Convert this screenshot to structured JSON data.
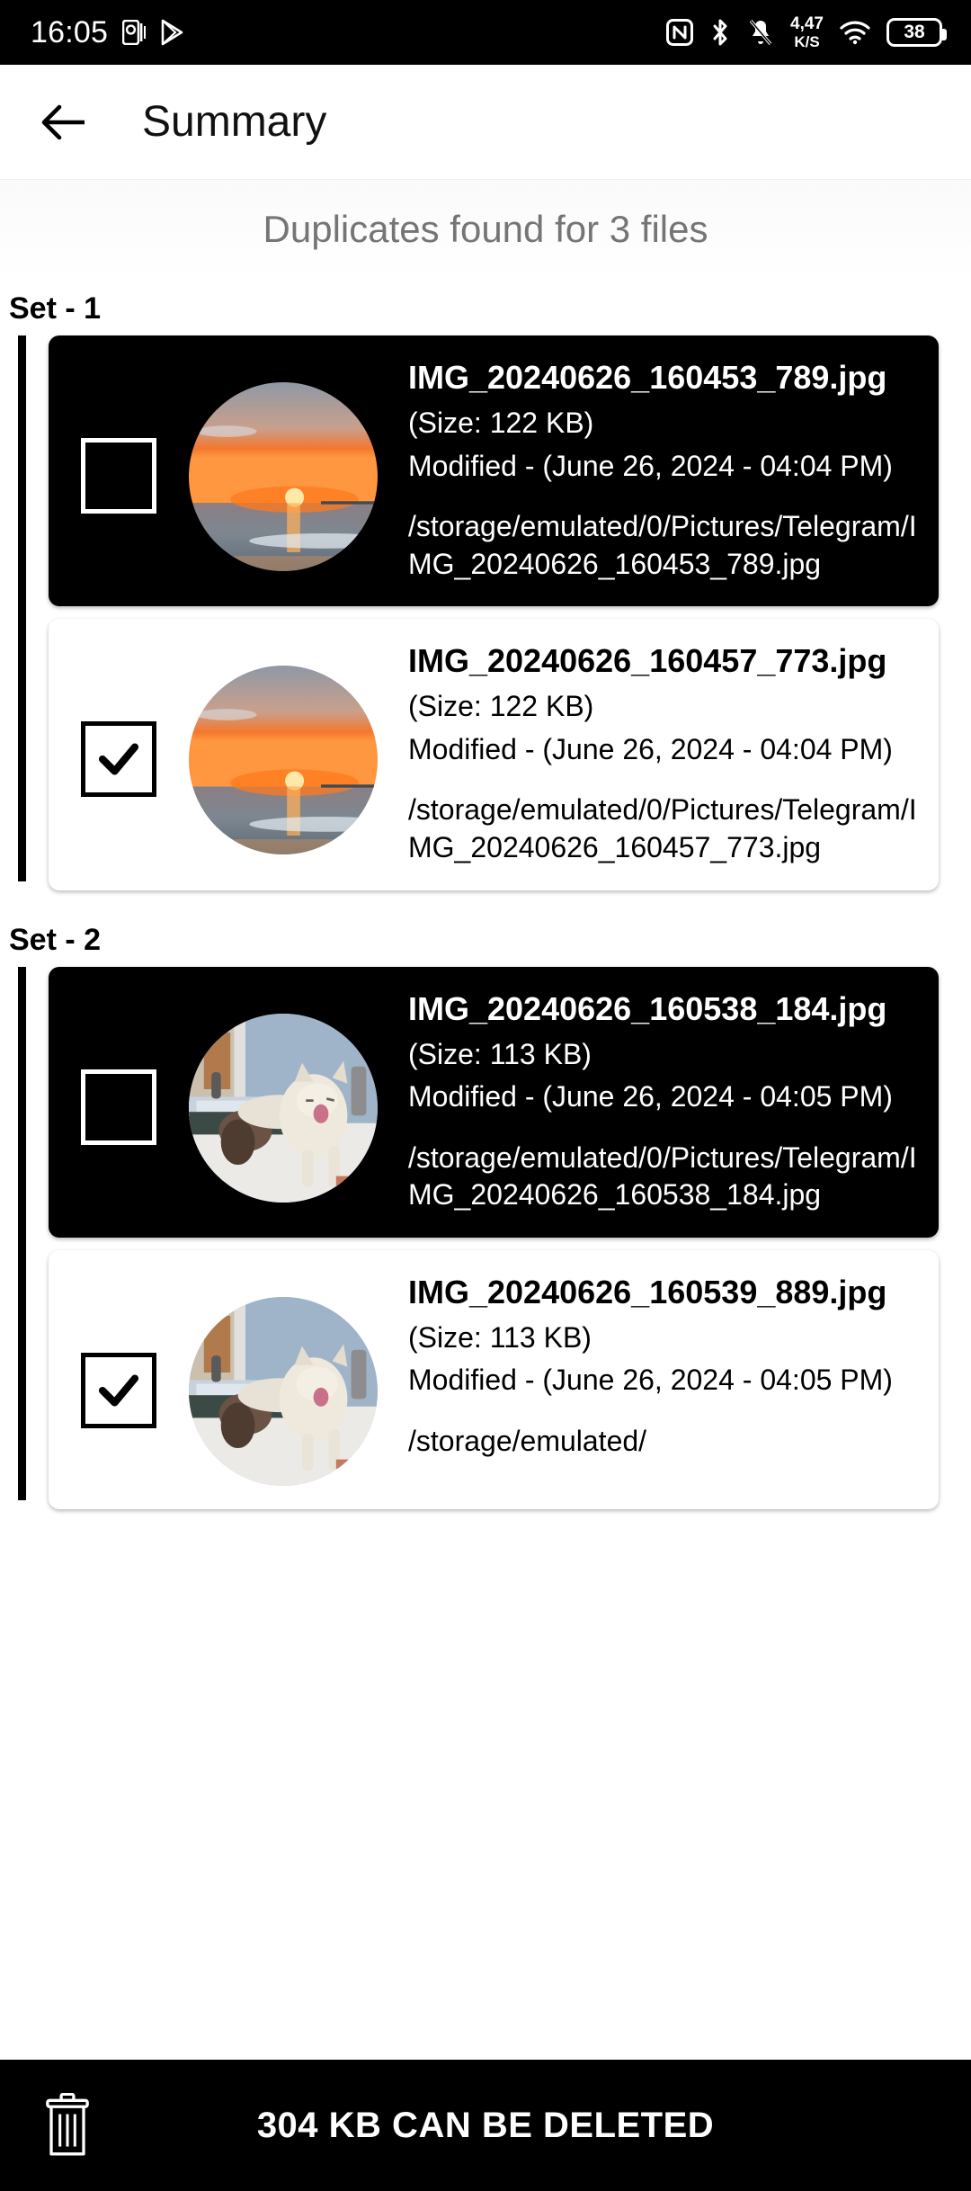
{
  "statusbar": {
    "time": "16:05",
    "left_icons": [
      "powerpoint-icon",
      "play-store-icon"
    ],
    "net_speed_value": "4,47",
    "net_speed_unit": "K/S",
    "battery_level": "38",
    "right_icons": [
      "nfc-icon",
      "bluetooth-icon",
      "notifications-off-icon",
      "wifi-icon",
      "battery-icon"
    ]
  },
  "appbar": {
    "back_label": "back-arrow",
    "title": "Summary"
  },
  "subtitle": "Duplicates found for 3 files",
  "sets": [
    {
      "label": "Set - 1",
      "files": [
        {
          "name": "IMG_20240626_160453_789.jpg",
          "size": "(Size: 122 KB)",
          "modified": "Modified - (June 26, 2024 - 04:04 PM)",
          "path": "/storage/emulated/0/Pictures/Telegram/IMG_20240626_160453_789.jpg",
          "selected": false,
          "theme": "dark",
          "thumbnail": "sunset-ocean-thumbnail"
        },
        {
          "name": "IMG_20240626_160457_773.jpg",
          "size": "(Size: 122 KB)",
          "modified": "Modified - (June 26, 2024 - 04:04 PM)",
          "path": "/storage/emulated/0/Pictures/Telegram/IMG_20240626_160457_773.jpg",
          "selected": true,
          "theme": "light",
          "thumbnail": "sunset-ocean-thumbnail"
        }
      ]
    },
    {
      "label": "Set - 2",
      "files": [
        {
          "name": "IMG_20240626_160538_184.jpg",
          "size": "(Size: 113 KB)",
          "modified": "Modified - (June 26, 2024 - 04:05 PM)",
          "path": "/storage/emulated/0/Pictures/Telegram/IMG_20240626_160538_184.jpg",
          "selected": false,
          "theme": "dark",
          "thumbnail": "cat-window-thumbnail"
        },
        {
          "name": "IMG_20240626_160539_889.jpg",
          "size": "(Size: 113 KB)",
          "modified": "Modified - (June 26, 2024 - 04:05 PM)",
          "path": "/storage/emulated/",
          "selected": true,
          "theme": "light",
          "thumbnail": "cat-window-thumbnail"
        }
      ]
    }
  ],
  "bottombar": {
    "icon": "trash-icon",
    "label": "304 KB CAN BE DELETED"
  },
  "colors": {
    "accent": "#000000",
    "subtitle": "#757575",
    "card_dark_bg": "#000000",
    "card_light_bg": "#ffffff"
  }
}
